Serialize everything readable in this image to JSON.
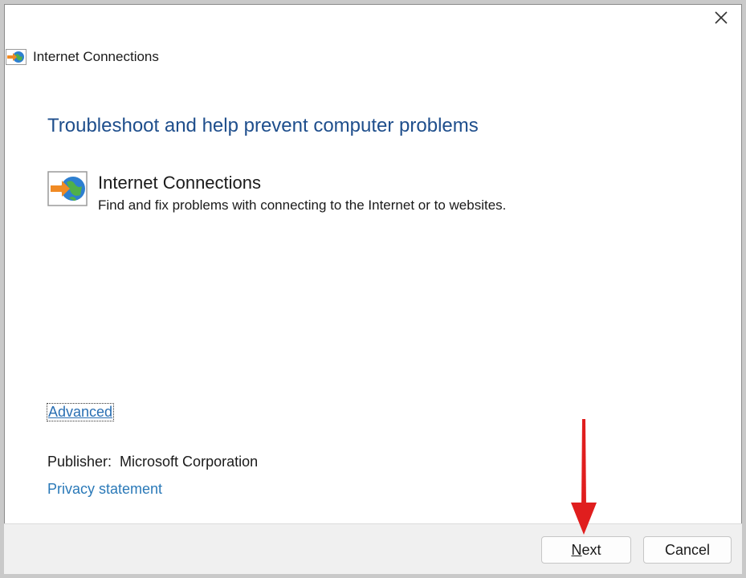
{
  "window": {
    "title": "Internet Connections",
    "close_glyph": "✕"
  },
  "main": {
    "heading": "Troubleshoot and help prevent computer problems",
    "item": {
      "icon": "internet-connections-icon",
      "title": "Internet Connections",
      "description": "Find and fix problems with connecting to the Internet or to websites."
    },
    "advanced_link": "Advanced",
    "publisher_label": "Publisher:",
    "publisher_value": "Microsoft Corporation",
    "privacy_link": "Privacy statement"
  },
  "footer": {
    "next_first": "N",
    "next_rest": "ext",
    "cancel_label": "Cancel"
  },
  "colors": {
    "heading": "#1e4e8c",
    "link": "#2a79b8",
    "annotation_arrow": "#e01e1e"
  }
}
